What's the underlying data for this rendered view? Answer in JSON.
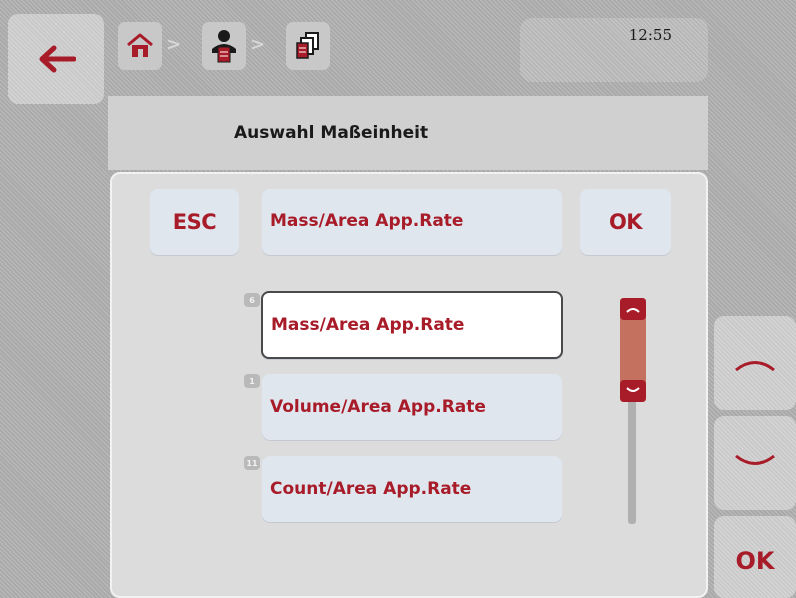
{
  "header": {
    "back_icon": "back-arrow-icon",
    "breadcrumb": [
      {
        "icon": "home-icon"
      },
      {
        "icon": "operator-icon"
      },
      {
        "icon": "unit-selection-icon"
      }
    ],
    "clock": "12:55"
  },
  "dialog": {
    "title": "Auswahl Maßeinheit",
    "esc_label": "ESC",
    "ok_label": "OK",
    "selected_value": "Mass/Area App.Rate",
    "options": [
      {
        "badge": "6",
        "label": "Mass/Area App.Rate",
        "selected": true
      },
      {
        "badge": "1",
        "label": "Volume/Area App.Rate",
        "selected": false
      },
      {
        "badge": "11",
        "label": "Count/Area App.Rate",
        "selected": false
      }
    ]
  },
  "side_buttons": {
    "up_icon": "chevron-up-icon",
    "down_icon": "chevron-down-icon",
    "ok_label": "OK"
  },
  "colors": {
    "accent": "#a81c2a",
    "button_bg": "#e0e6ee",
    "scroll_thumb": "#c5715f"
  }
}
